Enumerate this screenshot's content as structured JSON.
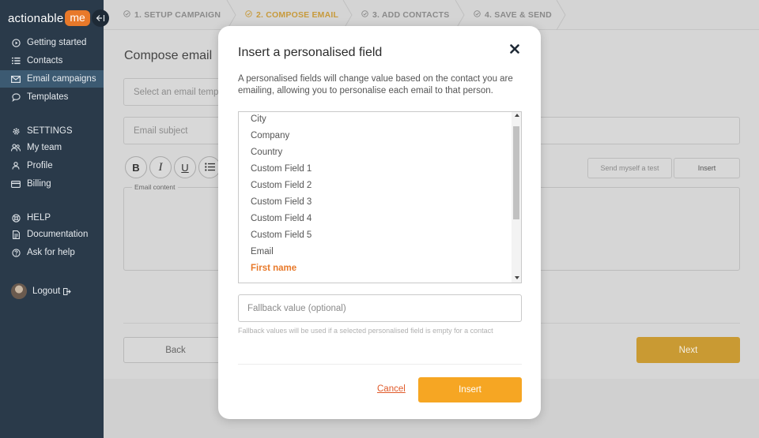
{
  "brand": {
    "name": "actionable",
    "badge": "me",
    "collapse_icon": "arrow-left-icon"
  },
  "sidebar": {
    "items": [
      {
        "label": "Getting started",
        "icon": "play-circle-icon"
      },
      {
        "label": "Contacts",
        "icon": "list-icon"
      },
      {
        "label": "Email campaigns",
        "icon": "envelope-icon",
        "active": true
      },
      {
        "label": "Templates",
        "icon": "speech-bubble-icon"
      }
    ],
    "settings_header": "SETTINGS",
    "settings_items": [
      {
        "label": "My team",
        "icon": "team-icon"
      },
      {
        "label": "Profile",
        "icon": "user-icon"
      },
      {
        "label": "Billing",
        "icon": "credit-card-icon"
      }
    ],
    "help_header": "HELP",
    "help_items": [
      {
        "label": "Documentation",
        "icon": "document-icon"
      },
      {
        "label": "Ask for help",
        "icon": "question-circle-icon"
      }
    ],
    "logout_label": "Logout"
  },
  "steps": [
    {
      "label": "1. SETUP CAMPAIGN",
      "current": false
    },
    {
      "label": "2. COMPOSE EMAIL",
      "current": true
    },
    {
      "label": "3. ADD CONTACTS",
      "current": false
    },
    {
      "label": "4. SAVE & SEND",
      "current": false
    }
  ],
  "compose": {
    "title": "Compose email",
    "template_placeholder": "Select an email temp",
    "subject_placeholder": "Email subject",
    "format_buttons": [
      "B",
      "I",
      "U",
      "list"
    ],
    "send_test_label": "Send myself a test",
    "insert_label": "Insert",
    "content_legend": "Email content",
    "back_label": "Back",
    "next_label": "Next"
  },
  "modal": {
    "title": "Insert a personalised field",
    "description": "A personalised fields will change value based on the contact you are emailing, allowing you to personalise each email to that person.",
    "fields": [
      "City",
      "Company",
      "Country",
      "Custom Field 1",
      "Custom Field 2",
      "Custom Field 3",
      "Custom Field 4",
      "Custom Field 5",
      "Email",
      "First name"
    ],
    "selected_field": "First name",
    "fallback_placeholder": "Fallback value (optional)",
    "fallback_value": "",
    "fallback_help": "Fallback values will be used if a selected personalised field is empty for a contact",
    "cancel_label": "Cancel",
    "insert_label": "Insert"
  },
  "colors": {
    "sidebar": "#2a3a4a",
    "accent": "#f6a623",
    "selected_text": "#e8792a",
    "cancel": "#e05a2a"
  }
}
